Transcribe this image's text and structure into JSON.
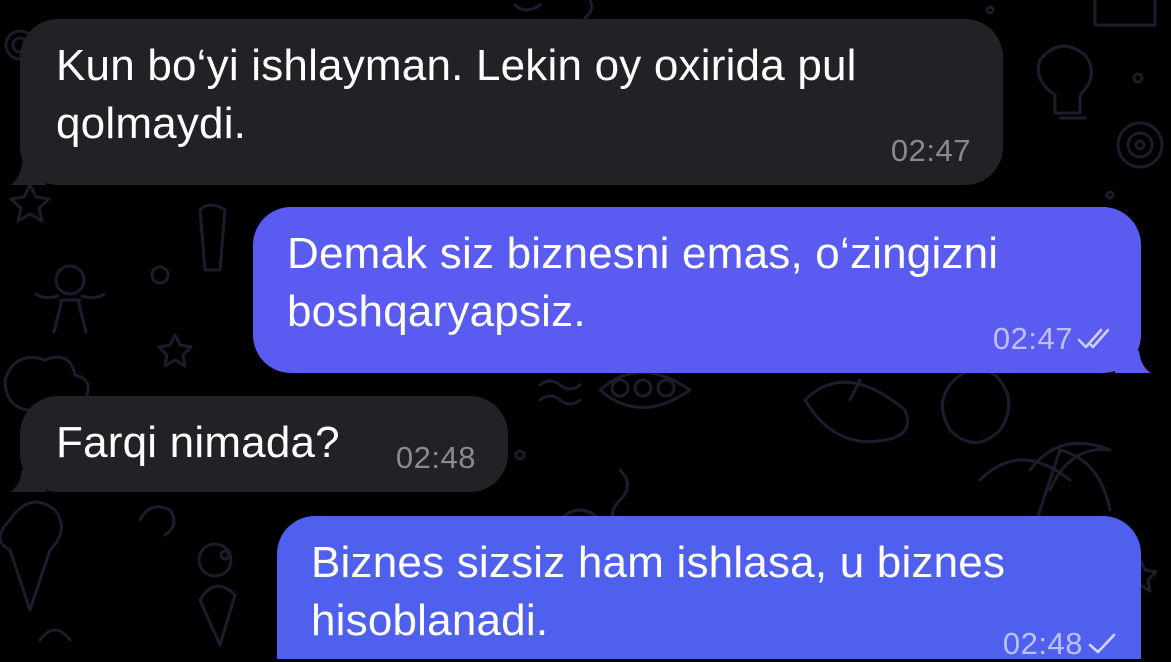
{
  "theme": {
    "background": "#000000",
    "incoming_bubble": "#232026",
    "outgoing_bubble_top": "#5b5cf0",
    "outgoing_bubble_bottom": "#4f5ff0",
    "pattern_color": "#1c1d2c"
  },
  "messages": [
    {
      "direction": "incoming",
      "text": "Kun bo‘yi ishlayman. Lekin oy oxirida pul\nqolmaydi.",
      "time": "02:47",
      "status_icon": "none"
    },
    {
      "direction": "outgoing",
      "text": "Demak siz biznesni emas, o‘zingizni\nboshqaryapsiz.",
      "time": "02:47",
      "status_icon": "double-check-icon"
    },
    {
      "direction": "incoming",
      "text": "Farqi nimada?",
      "time": "02:48",
      "status_icon": "none"
    },
    {
      "direction": "outgoing",
      "text": "Biznes sizsiz ham ishlasa, u biznes\nhisoblanadi.",
      "time": "02:48",
      "status_icon": "single-check-icon"
    }
  ]
}
